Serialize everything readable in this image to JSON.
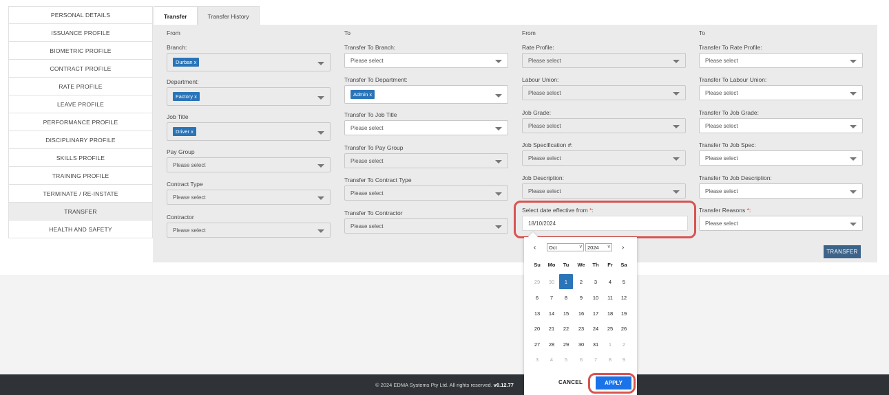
{
  "sidebar": {
    "items": [
      {
        "label": "PERSONAL DETAILS"
      },
      {
        "label": "ISSUANCE PROFILE"
      },
      {
        "label": "BIOMETRIC PROFILE"
      },
      {
        "label": "CONTRACT PROFILE"
      },
      {
        "label": "RATE PROFILE"
      },
      {
        "label": "LEAVE PROFILE"
      },
      {
        "label": "PERFORMANCE PROFILE"
      },
      {
        "label": "DISCIPLINARY PROFILE"
      },
      {
        "label": "SKILLS PROFILE"
      },
      {
        "label": "TRAINING PROFILE"
      },
      {
        "label": "TERMINATE / RE-INSTATE"
      },
      {
        "label": "TRANSFER"
      },
      {
        "label": "HEALTH AND SAFETY"
      }
    ]
  },
  "tabs": [
    {
      "label": "Transfer"
    },
    {
      "label": "Transfer History"
    }
  ],
  "columns": {
    "from1": "From",
    "to1": "To",
    "from2": "From",
    "to2": "To"
  },
  "fields": {
    "branch": {
      "label": "Branch:",
      "value": "Durban x"
    },
    "department": {
      "label": "Department:",
      "value": "Factory x"
    },
    "job_title": {
      "label": "Job Title",
      "value": "Driver x"
    },
    "pay_group": {
      "label": "Pay Group",
      "value": "Please select"
    },
    "contract_type": {
      "label": "Contract Type",
      "value": "Please select"
    },
    "contractor": {
      "label": "Contractor",
      "value": "Please select"
    },
    "to_branch": {
      "label": "Transfer To Branch:",
      "value": "Please select"
    },
    "to_department": {
      "label": "Transfer To Department:",
      "value": "Admin x"
    },
    "to_job_title": {
      "label": "Transfer To Job Title",
      "value": "Please select"
    },
    "to_pay_group": {
      "label": "Transfer To Pay Group",
      "value": "Please select"
    },
    "to_contract_type": {
      "label": "Transfer To Contract Type",
      "value": "Please select"
    },
    "to_contractor": {
      "label": "Transfer To Contractor",
      "value": "Please select"
    },
    "rate_profile": {
      "label": "Rate Profile:",
      "value": "Please select"
    },
    "labour_union": {
      "label": "Labour Union:",
      "value": "Please select"
    },
    "job_grade": {
      "label": "Job Grade:",
      "value": "Please select"
    },
    "job_spec": {
      "label": "Job Specification #:",
      "value": "Please select"
    },
    "job_desc": {
      "label": "Job Description:",
      "value": "Please select"
    },
    "date_effective": {
      "label": "Select date effective from ",
      "req": "*",
      "suffix": ":",
      "value": "18/10/2024"
    },
    "to_rate_profile": {
      "label": "Transfer To Rate Profile:",
      "value": "Please select"
    },
    "to_labour_union": {
      "label": "Transfer To Labour Union:",
      "value": "Please select"
    },
    "to_job_grade": {
      "label": "Transfer To Job Grade:",
      "value": "Please select"
    },
    "to_job_spec": {
      "label": "Transfer To Job Spec:",
      "value": "Please select"
    },
    "to_job_desc": {
      "label": "Transfer To Job Description:",
      "value": "Please select"
    },
    "transfer_reasons": {
      "label": "Transfer Reasons ",
      "req": "*",
      "suffix": ":",
      "value": "Please select"
    }
  },
  "transfer_button": "TRANSFER",
  "calendar": {
    "prev": "‹",
    "next": "›",
    "month": "Oct",
    "year": "2024",
    "weekdays": [
      "Su",
      "Mo",
      "Tu",
      "We",
      "Th",
      "Fr",
      "Sa"
    ],
    "weeks": [
      [
        "29",
        "30",
        "1",
        "2",
        "3",
        "4",
        "5"
      ],
      [
        "6",
        "7",
        "8",
        "9",
        "10",
        "11",
        "12"
      ],
      [
        "13",
        "14",
        "15",
        "16",
        "17",
        "18",
        "19"
      ],
      [
        "20",
        "21",
        "22",
        "23",
        "24",
        "25",
        "26"
      ],
      [
        "27",
        "28",
        "29",
        "30",
        "31",
        "1",
        "2"
      ],
      [
        "3",
        "4",
        "5",
        "6",
        "7",
        "8",
        "9"
      ]
    ],
    "selected": "1",
    "cancel": "CANCEL",
    "apply": "APPLY"
  },
  "footer": {
    "text": "© 2024 EDMA Systems Pty Ltd. All rights reserved.",
    "version": "v0.12.77"
  },
  "colors": {
    "accent": "#2a74b8",
    "apply": "#1a73e8",
    "highlight": "#d9534f",
    "footer": "#2f3338"
  }
}
